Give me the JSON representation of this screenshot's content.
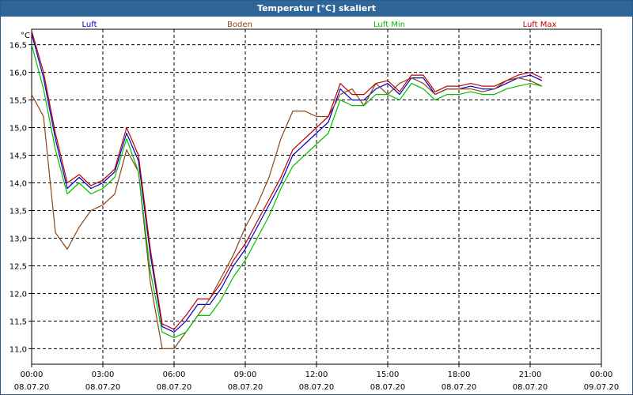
{
  "window": {
    "title": "Temperatur [°C] skaliert"
  },
  "chart_data": {
    "type": "line",
    "title": "Temperatur [°C] skaliert",
    "ylabel": "°C",
    "xlim": [
      0,
      24
    ],
    "ylim": [
      10.72,
      16.78
    ],
    "grid": true,
    "legend": "top",
    "y_ticks": [
      "11,0",
      "11,5",
      "12,0",
      "12,5",
      "13,0",
      "13,5",
      "14,0",
      "14,5",
      "15,0",
      "15,5",
      "16,0",
      "16,5"
    ],
    "y_tick_values": [
      11.0,
      11.5,
      12.0,
      12.5,
      13.0,
      13.5,
      14.0,
      14.5,
      15.0,
      15.5,
      16.0,
      16.5
    ],
    "x_ticks": [
      {
        "time": "00:00",
        "date": "08.07.20"
      },
      {
        "time": "03:00",
        "date": "08.07.20"
      },
      {
        "time": "06:00",
        "date": "08.07.20"
      },
      {
        "time": "09:00",
        "date": "08.07.20"
      },
      {
        "time": "12:00",
        "date": "08.07.20"
      },
      {
        "time": "15:00",
        "date": "08.07.20"
      },
      {
        "time": "18:00",
        "date": "08.07.20"
      },
      {
        "time": "21:00",
        "date": "08.07.20"
      },
      {
        "time": "00:00",
        "date": "09.07.20"
      }
    ],
    "x": [
      0,
      0.5,
      1,
      1.5,
      2,
      2.5,
      3,
      3.5,
      4,
      4.5,
      5,
      5.5,
      6,
      6.5,
      7,
      7.5,
      8,
      8.5,
      9,
      9.5,
      10,
      10.5,
      11,
      11.5,
      12,
      12.5,
      13,
      13.5,
      14,
      14.5,
      15,
      15.5,
      16,
      16.5,
      17,
      17.5,
      18,
      18.5,
      19,
      19.5,
      20,
      20.5,
      21,
      21.5,
      22,
      22.5,
      23,
      23.5,
      24
    ],
    "series": [
      {
        "name": "Luft",
        "color": "#0000c8",
        "values": [
          16.7,
          15.9,
          14.8,
          13.9,
          14.1,
          13.9,
          14.0,
          14.2,
          14.9,
          14.4,
          12.7,
          11.4,
          11.3,
          11.5,
          11.8,
          11.8,
          12.1,
          12.5,
          12.8,
          13.2,
          13.6,
          14.0,
          14.5,
          14.7,
          14.9,
          15.1,
          15.7,
          15.5,
          15.5,
          15.7,
          15.8,
          15.6,
          15.9,
          15.9,
          15.6,
          15.7,
          15.7,
          15.75,
          15.7,
          15.7,
          15.8,
          15.9,
          15.95,
          15.85
        ]
      },
      {
        "name": "Boden",
        "color": "#8b4513",
        "values": [
          15.6,
          15.2,
          13.1,
          12.8,
          13.2,
          13.5,
          13.6,
          13.8,
          14.6,
          14.2,
          12.2,
          11.0,
          11.0,
          11.3,
          11.6,
          11.9,
          12.3,
          12.7,
          13.2,
          13.6,
          14.1,
          14.8,
          15.3,
          15.3,
          15.2,
          15.2,
          15.6,
          15.7,
          15.4,
          15.8,
          15.6,
          15.8,
          15.9,
          15.8,
          15.6,
          15.7,
          15.7,
          15.7,
          15.65,
          15.7,
          15.85,
          15.9,
          15.85,
          15.75
        ]
      },
      {
        "name": "Luft Min",
        "color": "#00c000",
        "values": [
          16.5,
          15.7,
          14.6,
          13.8,
          14.0,
          13.8,
          13.9,
          14.1,
          14.8,
          14.2,
          12.4,
          11.3,
          11.2,
          11.3,
          11.6,
          11.6,
          11.9,
          12.3,
          12.6,
          13.0,
          13.4,
          13.9,
          14.3,
          14.5,
          14.7,
          14.9,
          15.5,
          15.4,
          15.4,
          15.6,
          15.6,
          15.5,
          15.8,
          15.7,
          15.5,
          15.6,
          15.6,
          15.65,
          15.6,
          15.6,
          15.7,
          15.75,
          15.8,
          15.75
        ]
      },
      {
        "name": "Luft Max",
        "color": "#c00000",
        "values": [
          16.75,
          16.0,
          14.9,
          14.0,
          14.15,
          13.95,
          14.05,
          14.25,
          15.0,
          14.5,
          12.8,
          11.45,
          11.35,
          11.6,
          11.9,
          11.9,
          12.2,
          12.6,
          12.9,
          13.3,
          13.7,
          14.1,
          14.6,
          14.8,
          15.0,
          15.2,
          15.8,
          15.6,
          15.6,
          15.8,
          15.85,
          15.65,
          15.95,
          15.95,
          15.65,
          15.75,
          15.75,
          15.8,
          15.75,
          15.75,
          15.85,
          15.95,
          16.0,
          15.9
        ]
      }
    ]
  }
}
